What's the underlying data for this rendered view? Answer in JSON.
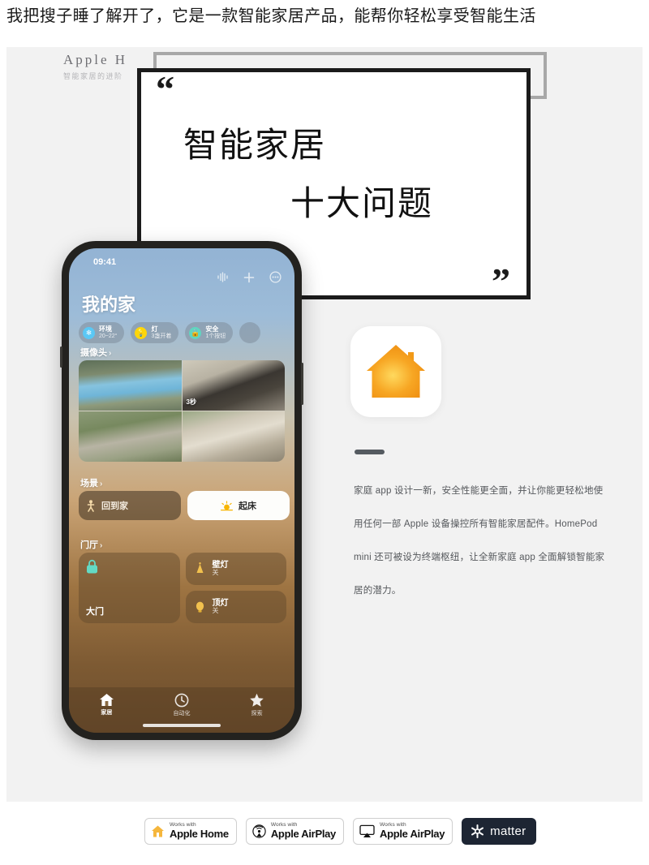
{
  "headline": "我把搜子睡了解开了，它是一款智能家居产品，能帮你轻松享受智能生活",
  "wordmark": {
    "main": "Apple H",
    "sub": "智能家居的进阶"
  },
  "bubble": {
    "quote_open": "“",
    "quote_close": "”",
    "line1": "智能家居",
    "line2": "十大问题"
  },
  "phone": {
    "status_time": "09:41",
    "nav_icons": [
      "audio-waveform-icon",
      "plus-icon",
      "more-circle-icon"
    ],
    "home_title": "我的家",
    "chips": [
      {
        "icon": "climate-icon",
        "title": "环境",
        "sub": "20~22°",
        "color": "#5ac8f5"
      },
      {
        "icon": "light-bulb-icon",
        "title": "灯",
        "sub": "3盏开着",
        "color": "#ffd60a"
      },
      {
        "icon": "lock-icon",
        "title": "安全",
        "sub": "1个按钮",
        "color": "#5fd6c0"
      }
    ],
    "cameras": {
      "heading": "摄像头",
      "chevron": "›",
      "tiles": [
        {
          "name": "pool-camera",
          "badge": ""
        },
        {
          "name": "bedroom-camera",
          "badge": "3秒"
        },
        {
          "name": "yard-camera",
          "badge": ""
        },
        {
          "name": "living-room-camera",
          "badge": ""
        }
      ]
    },
    "scenes": {
      "heading": "场景",
      "chevron": "›",
      "items": [
        {
          "label": "回到家",
          "icon": "walking-person-icon",
          "state": "off"
        },
        {
          "label": "起床",
          "icon": "sunrise-icon",
          "state": "on"
        }
      ]
    },
    "hallway": {
      "heading": "门厅",
      "chevron": "›",
      "door": {
        "label": "大门",
        "icon": "lock-icon"
      },
      "lights": [
        {
          "title": "壁灯",
          "sub": "关",
          "icon": "wall-lamp-icon"
        },
        {
          "title": "顶灯",
          "sub": "关",
          "icon": "ceiling-lamp-icon"
        }
      ]
    },
    "tabs": [
      {
        "label": "家居",
        "icon": "house-icon",
        "active": true
      },
      {
        "label": "自动化",
        "icon": "clock-icon",
        "active": false
      },
      {
        "label": "探索",
        "icon": "star-icon",
        "active": false
      }
    ]
  },
  "right": {
    "app_icon_name": "apple-home-app-icon",
    "body": "家庭 app 设计一新，安全性能更全面，并让你能更轻松地使用任何一部 Apple 设备操控所有智能家居配件。HomePod mini 还可被设为终端枢纽，让全新家庭 app 全面解锁智能家居的潜力。"
  },
  "badges": [
    {
      "works": "Works with",
      "name": "Apple Home",
      "icon": "home-badge-icon"
    },
    {
      "works": "Works with",
      "name": "Apple AirPlay",
      "icon": "airplay-audio-icon"
    },
    {
      "works": "Works with",
      "name": "Apple AirPlay",
      "icon": "airplay-video-icon"
    },
    {
      "name": "matter",
      "icon": "matter-logo-icon"
    }
  ],
  "colors": {
    "accent_orange": "#f5a623",
    "background": "#f2f2f2",
    "bubble_border": "#1b1b1b",
    "matter_bg": "#1d2533"
  }
}
